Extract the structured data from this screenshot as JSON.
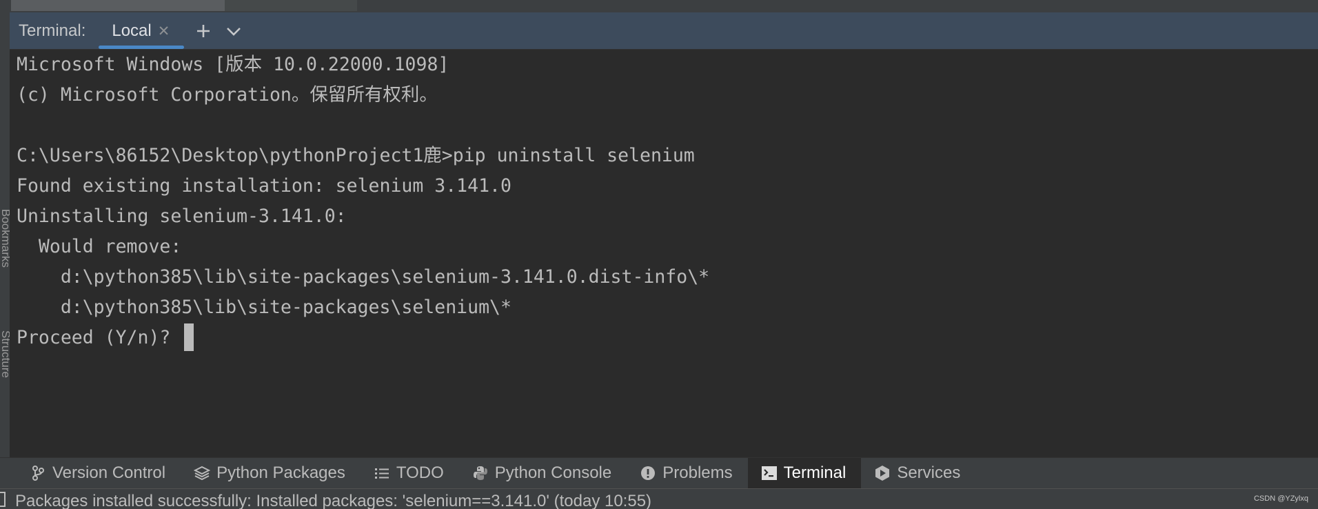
{
  "terminal": {
    "title": "Terminal:",
    "tab_label": "Local",
    "lines": [
      "Microsoft Windows [版本 10.0.22000.1098]",
      "(c) Microsoft Corporation。保留所有权利。",
      "",
      "C:\\Users\\86152\\Desktop\\pythonProject1鹿>pip uninstall selenium",
      "Found existing installation: selenium 3.141.0",
      "Uninstalling selenium-3.141.0:",
      "  Would remove:",
      "    d:\\python385\\lib\\site-packages\\selenium-3.141.0.dist-info\\*",
      "    d:\\python385\\lib\\site-packages\\selenium\\*",
      "Proceed (Y/n)? "
    ]
  },
  "left_strip": {
    "labels": [
      "Bookmarks",
      "Structure"
    ]
  },
  "bottom_toolbar": {
    "tabs": [
      {
        "label": "Version Control",
        "icon": "branch-icon"
      },
      {
        "label": "Python Packages",
        "icon": "layers-icon"
      },
      {
        "label": "TODO",
        "icon": "list-icon"
      },
      {
        "label": "Python Console",
        "icon": "python-icon"
      },
      {
        "label": "Problems",
        "icon": "warning-icon"
      },
      {
        "label": "Terminal",
        "icon": "terminal-icon",
        "active": true
      },
      {
        "label": "Services",
        "icon": "services-icon"
      }
    ]
  },
  "status_bar": {
    "text": "Packages installed successfully: Installed packages: 'selenium==3.141.0' (today 10:55)"
  },
  "watermark": "CSDN @YZylxq",
  "colors": {
    "background": "#2b2b2b",
    "header": "#3d4b5c",
    "accent": "#4a88c7",
    "text": "#bbbbbb"
  }
}
